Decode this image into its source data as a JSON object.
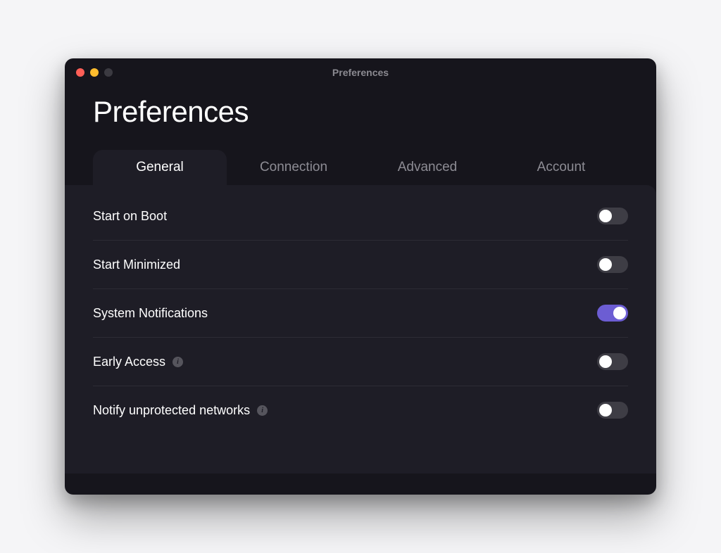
{
  "window": {
    "title": "Preferences"
  },
  "page": {
    "title": "Preferences"
  },
  "tabs": [
    {
      "id": "general",
      "label": "General",
      "active": true
    },
    {
      "id": "connection",
      "label": "Connection",
      "active": false
    },
    {
      "id": "advanced",
      "label": "Advanced",
      "active": false
    },
    {
      "id": "account",
      "label": "Account",
      "active": false
    }
  ],
  "settings": {
    "start_on_boot": {
      "label": "Start on Boot",
      "enabled": false,
      "info": false
    },
    "start_minimized": {
      "label": "Start Minimized",
      "enabled": false,
      "info": false
    },
    "system_notifications": {
      "label": "System Notifications",
      "enabled": true,
      "info": false
    },
    "early_access": {
      "label": "Early Access",
      "enabled": false,
      "info": true
    },
    "notify_unprotected": {
      "label": "Notify unprotected networks",
      "enabled": false,
      "info": true
    }
  },
  "colors": {
    "accent": "#6c5dd3",
    "window_bg": "#16151c",
    "panel_bg": "#1e1d26"
  }
}
